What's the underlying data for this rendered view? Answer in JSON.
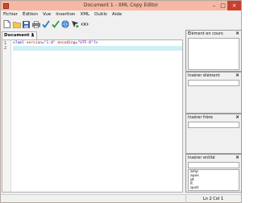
{
  "window": {
    "title": "Document 1 - XML Copy Editor"
  },
  "menu": [
    "Fichier",
    "Édition",
    "Vue",
    "Insertion",
    "XML",
    "Outils",
    "Aide"
  ],
  "toolbar": {
    "icons": [
      "new-document-icon",
      "open-folder-icon",
      "save-icon",
      "print-icon",
      "check-wellformed-icon",
      "validate-icon",
      "globe-icon",
      "xpath-icon",
      "xslt-icon"
    ],
    "colors": {
      "check": "#1f7fc8",
      "validate": "#2e9d3a",
      "globe": "#1f6fb8"
    }
  },
  "tab": {
    "label": "Document 1",
    "close": "×"
  },
  "editor": {
    "line_numbers": [
      "1",
      "2"
    ],
    "code": {
      "open": "<?xml",
      "attr1": "version",
      "val1": "\"1.0\"",
      "attr2": "encoding",
      "val2": "\"UTF-8\"",
      "close": "?>"
    },
    "current_line_color": "#cfeff4"
  },
  "panels": {
    "current_element": {
      "title": "Élément en cours",
      "close": "×"
    },
    "insert_element": {
      "title": "Insérer élément",
      "close": "×"
    },
    "insert_sibling": {
      "title": "Insérer frère",
      "close": "×"
    },
    "insert_entity": {
      "title": "Insérer entité",
      "close": "×",
      "items": [
        "amp",
        "apos",
        "gt",
        "lt",
        "quot"
      ]
    }
  },
  "status": {
    "position": "Ln 2 Col 1"
  }
}
